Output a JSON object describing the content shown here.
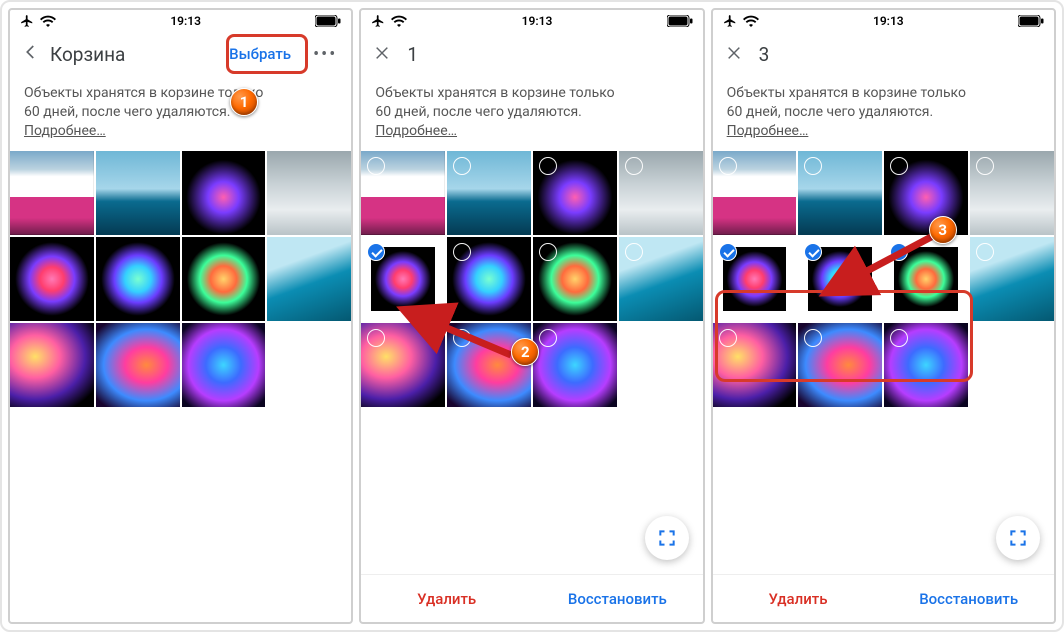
{
  "status": {
    "time": "19:13"
  },
  "screen1": {
    "title": "Корзина",
    "select": "Выбрать",
    "info_l1": "Объекты хранятся в корзине только",
    "info_l2": "60 дней, после чего удаляются.",
    "more": "Подробнее…"
  },
  "screen2": {
    "count": "1",
    "info_l1": "Объекты хранятся в корзине только",
    "info_l2": "60 дней, после чего удаляются.",
    "more": "Подробнее…",
    "delete": "Удалить",
    "restore": "Восстановить"
  },
  "screen3": {
    "count": "3",
    "info_l1": "Объекты хранятся в корзине только",
    "info_l2": "60 дней, после чего удаляются.",
    "more": "Подробнее…",
    "delete": "Удалить",
    "restore": "Восстановить"
  },
  "badges": {
    "b1": "1",
    "b2": "2",
    "b3": "3"
  }
}
